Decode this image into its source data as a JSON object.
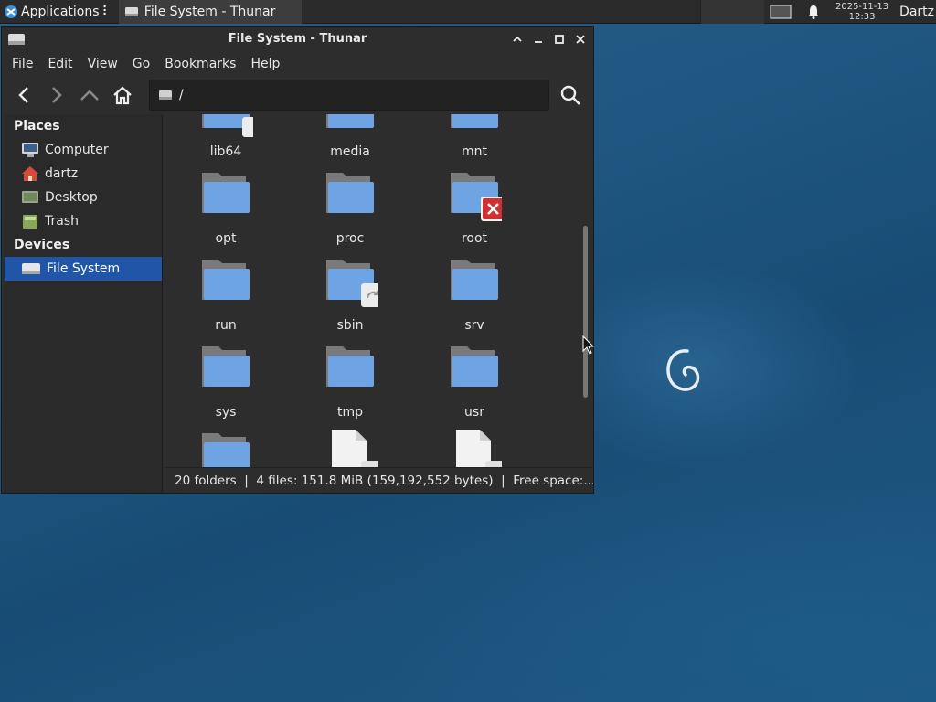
{
  "panel": {
    "applications_label": "Applications",
    "task_title": "File System - Thunar",
    "clock_date": "2025-11-13",
    "clock_time": "12:33",
    "user": "Dartz"
  },
  "window": {
    "title": "File System - Thunar",
    "menu": [
      "File",
      "Edit",
      "View",
      "Go",
      "Bookmarks",
      "Help"
    ],
    "path": "/"
  },
  "sidebar": {
    "places_header": "Places",
    "places": [
      "Computer",
      "dartz",
      "Desktop",
      "Trash"
    ],
    "devices_header": "Devices",
    "devices": [
      "File System"
    ]
  },
  "files": {
    "row0": [
      "lib64",
      "media",
      "mnt"
    ],
    "row1": [
      "opt",
      "proc",
      "root"
    ],
    "row2": [
      "run",
      "sbin",
      "srv"
    ],
    "row3": [
      "sys",
      "tmp",
      "usr"
    ]
  },
  "status": {
    "text": "20 folders  |  4 files: 151.8 MiB (159,192,552 bytes)  |  Free space:..."
  },
  "colors": {
    "accent": "#2055a8",
    "folder": "#6ea3e4",
    "window_bg": "#2d2d2d"
  }
}
